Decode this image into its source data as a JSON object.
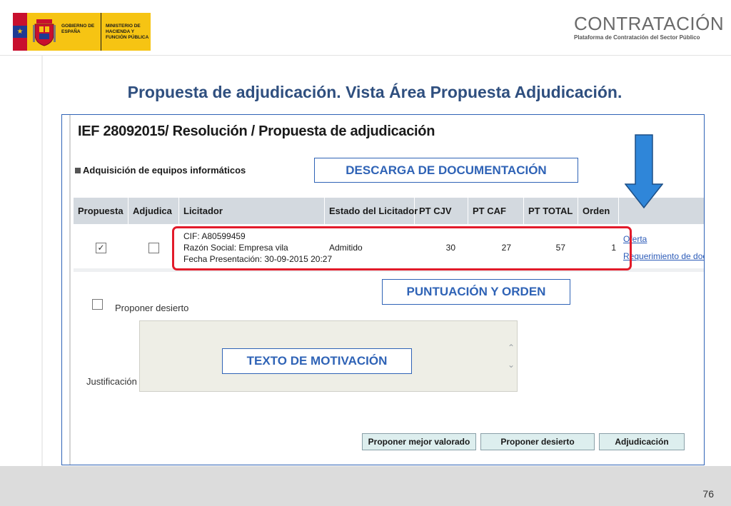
{
  "header": {
    "gov_flag_stars": "★",
    "gov_text_1": "GOBIERNO DE ESPAÑA",
    "gov_text_2": "MINISTERIO DE HACIENDA Y FUNCIÓN PÚBLICA",
    "brand_title": "CONTRATACIÓN",
    "brand_subtitle": "Plataforma de Contratación del Sector Público"
  },
  "slide": {
    "title": "Propuesta de adjudicación.  Vista Área Propuesta Adjudicación.",
    "page_number": "76"
  },
  "screen": {
    "heading": "IEF 28092015/ Resolución / Propuesta de adjudicación",
    "section": "Adquisición de equipos informáticos",
    "table": {
      "columns": [
        "Propuesta",
        "Adjudica",
        "Licitador",
        "Estado del Licitador",
        "PT CJV",
        "PT CAF",
        "PT TOTAL",
        "Orden"
      ],
      "row": {
        "propuesta_checked": "✓",
        "cif": "CIF: A80599459",
        "razon_social": "Razón Social: Empresa vila",
        "fecha": "Fecha Presentación: 30-09-2015 20:27",
        "estado": "Admitido",
        "pt_cjv": "30",
        "pt_caf": "27",
        "pt_total": "57",
        "orden": "1",
        "link_oferta": "Oferta",
        "link_requerimiento": "Requerimiento de docu"
      }
    },
    "proponer_desierto_label": "Proponer desierto",
    "justificacion_label": "Justificación",
    "scroll_up": "⌃",
    "scroll_down": "⌄",
    "buttons": {
      "mejor_valorado": "Proponer mejor valorado",
      "desierto": "Proponer desierto",
      "adjudicacion": "Adjudicación"
    }
  },
  "callouts": {
    "descarga": "DESCARGA DE DOCUMENTACIÓN",
    "puntuacion": "PUNTUACIÓN Y ORDEN",
    "motivacion": "TEXTO DE MOTIVACIÓN"
  },
  "colors": {
    "title_blue": "#2f4f7f",
    "callout_blue": "#2f63b6",
    "highlight_red": "#e21b2a",
    "arrow_blue": "#2f86d9",
    "gov_yellow": "#f6c413"
  }
}
